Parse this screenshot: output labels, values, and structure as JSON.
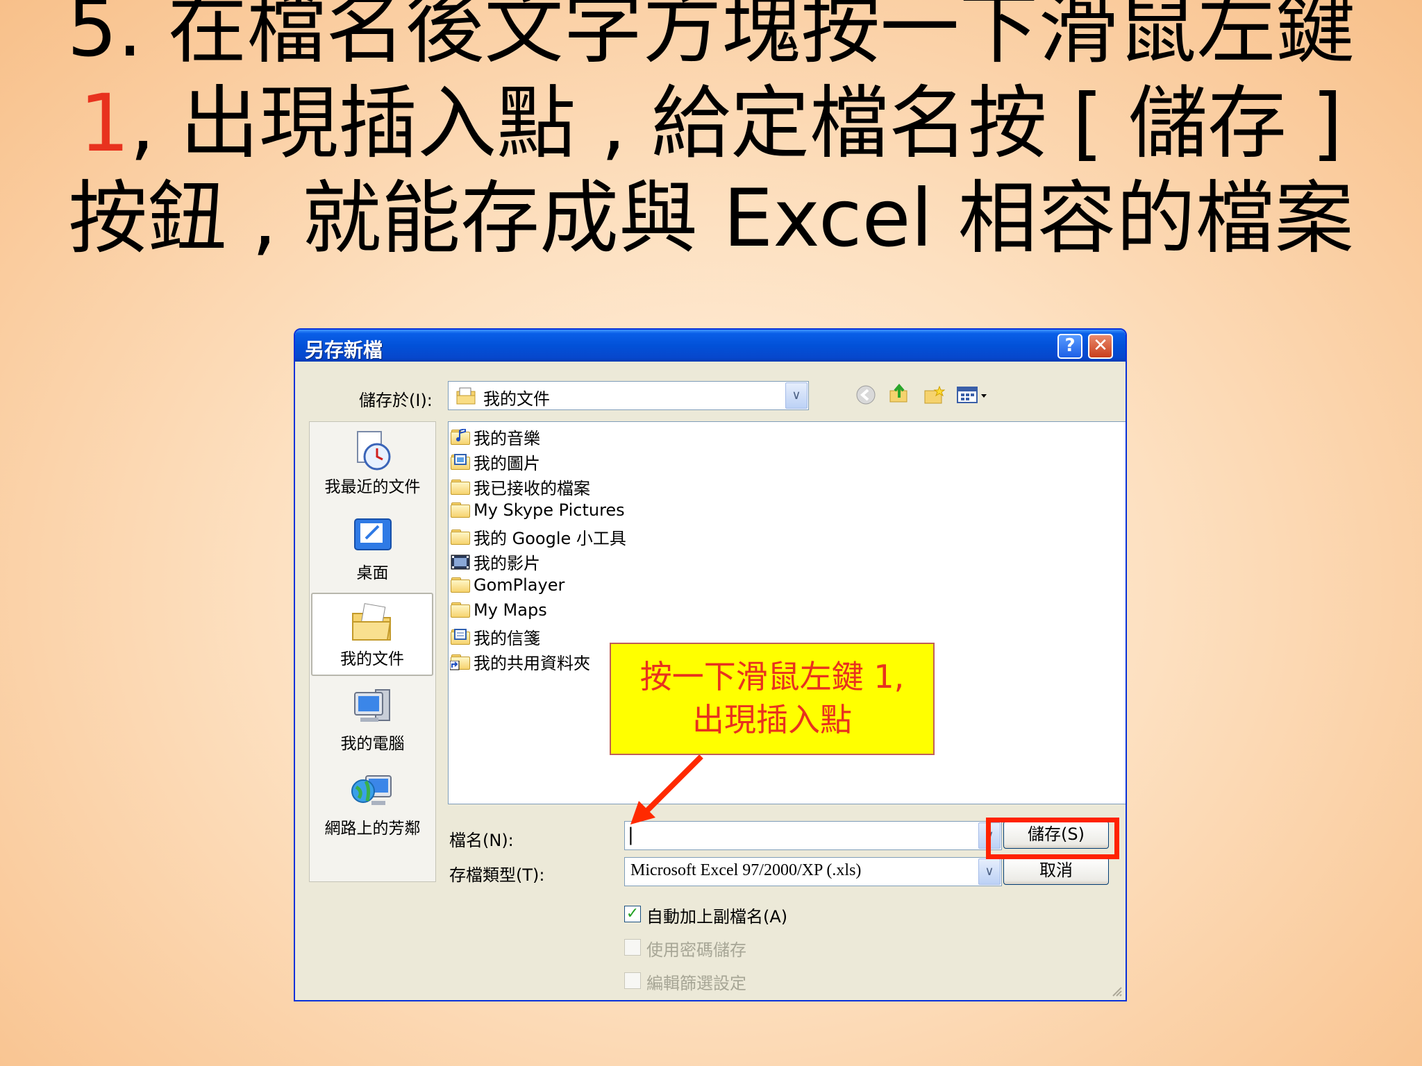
{
  "slide": {
    "title_part1": "5. 在檔名後文字方塊按一下滑鼠左鍵 ",
    "title_num": "1",
    "title_part2": ", 出現插入點 , 給定檔名按 [ 儲存 ] 按鈕 , 就能存成與 Excel  相容的檔案"
  },
  "dialog": {
    "title": "另存新檔",
    "help_label": "?",
    "close_label": "✕",
    "save_in_label": "儲存於(I):",
    "save_in_value": "我的文件",
    "dropdown_glyph": "∨",
    "toolbar_icons": [
      "back-icon",
      "up-folder-icon",
      "new-folder-icon",
      "views-menu-icon"
    ],
    "places": [
      {
        "label": "我最近的文件",
        "icon": "recent-documents-icon"
      },
      {
        "label": "桌面",
        "icon": "desktop-icon"
      },
      {
        "label": "我的文件",
        "icon": "my-documents-icon",
        "selected": true
      },
      {
        "label": "我的電腦",
        "icon": "my-computer-icon"
      },
      {
        "label": "網路上的芳鄰",
        "icon": "network-places-icon"
      }
    ],
    "files": [
      {
        "name": "我的音樂",
        "icon": "music-folder-icon"
      },
      {
        "name": "我的圖片",
        "icon": "pictures-folder-icon"
      },
      {
        "name": "我已接收的檔案",
        "icon": "folder-icon"
      },
      {
        "name": "My Skype Pictures",
        "icon": "folder-icon"
      },
      {
        "name": "我的 Google 小工具",
        "icon": "folder-icon"
      },
      {
        "name": "我的影片",
        "icon": "video-folder-icon"
      },
      {
        "name": "GomPlayer",
        "icon": "folder-icon"
      },
      {
        "name": "My Maps",
        "icon": "folder-icon"
      },
      {
        "name": "我的信箋",
        "icon": "stationery-folder-icon"
      },
      {
        "name": "我的共用資料夾",
        "icon": "shared-folder-icon"
      }
    ],
    "filename_label": "檔名(N):",
    "filename_value": "|",
    "filetype_label": "存檔類型(T):",
    "filetype_value": "Microsoft Excel 97/2000/XP (.xls)",
    "save_button": "儲存(S)",
    "cancel_button": "取消",
    "options": [
      {
        "label": "自動加上副檔名(A)",
        "checked": true,
        "enabled": true
      },
      {
        "label": "使用密碼儲存",
        "checked": false,
        "enabled": false
      },
      {
        "label": "編輯篩選設定",
        "checked": false,
        "enabled": false
      }
    ]
  },
  "callout": {
    "line1": "按一下滑鼠左鍵 1,",
    "line2": "出現插入點"
  },
  "colors": {
    "accent_red": "#e8321e",
    "callout_yellow": "#ffff00",
    "xp_title_blue": "#0251d8"
  }
}
